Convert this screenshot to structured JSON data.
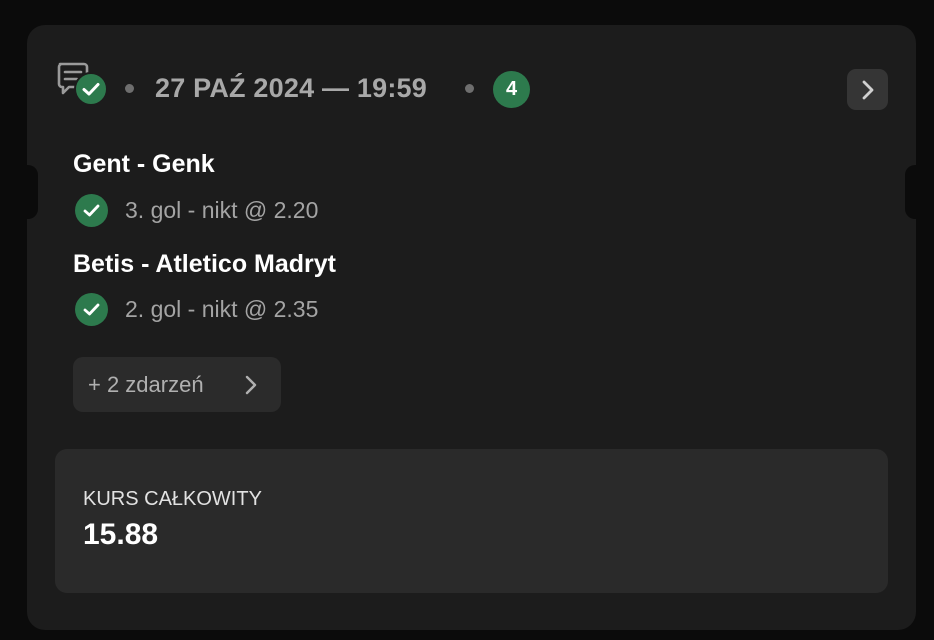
{
  "header": {
    "date_time": "27 PAŹ 2024 — 19:59",
    "events_count": "4",
    "slip_icon": "bet-slip-check-icon",
    "next_icon": "chevron-right-icon"
  },
  "events": [
    {
      "title": "Gent - Genk",
      "pick": "3. gol - nikt  @ 2.20",
      "status_icon": "check-icon"
    },
    {
      "title": "Betis - Atletico Madryt",
      "pick": "2. gol - nikt  @ 2.35",
      "status_icon": "check-icon"
    }
  ],
  "more_events": {
    "label": "+ 2 zdarzeń",
    "icon": "chevron-right-icon"
  },
  "total": {
    "label": "KURS CAŁKOWITY",
    "value": "15.88"
  },
  "colors": {
    "background": "#0b0b0b",
    "card": "#1c1c1c",
    "panel": "#2a2a2a",
    "success_green": "#2d7a4d",
    "muted_text": "#a8a8a8",
    "primary_text": "#ffffff"
  }
}
